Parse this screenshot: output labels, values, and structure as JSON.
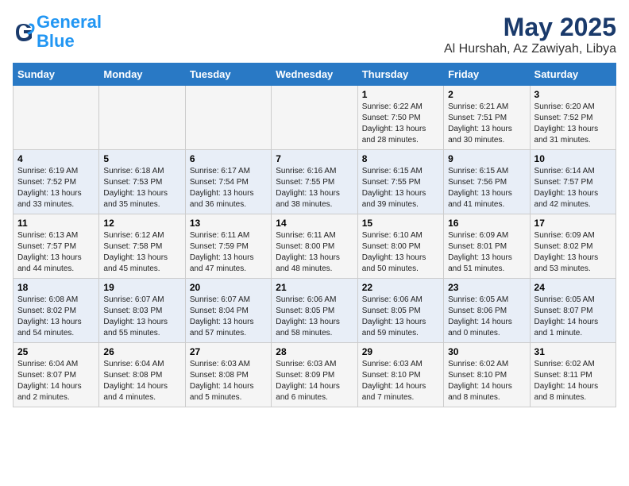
{
  "header": {
    "logo_line1": "General",
    "logo_line2": "Blue",
    "title": "May 2025",
    "subtitle": "Al Hurshah, Az Zawiyah, Libya"
  },
  "weekdays": [
    "Sunday",
    "Monday",
    "Tuesday",
    "Wednesday",
    "Thursday",
    "Friday",
    "Saturday"
  ],
  "weeks": [
    [
      {
        "day": "",
        "info": ""
      },
      {
        "day": "",
        "info": ""
      },
      {
        "day": "",
        "info": ""
      },
      {
        "day": "",
        "info": ""
      },
      {
        "day": "1",
        "info": "Sunrise: 6:22 AM\nSunset: 7:50 PM\nDaylight: 13 hours and 28 minutes."
      },
      {
        "day": "2",
        "info": "Sunrise: 6:21 AM\nSunset: 7:51 PM\nDaylight: 13 hours and 30 minutes."
      },
      {
        "day": "3",
        "info": "Sunrise: 6:20 AM\nSunset: 7:52 PM\nDaylight: 13 hours and 31 minutes."
      }
    ],
    [
      {
        "day": "4",
        "info": "Sunrise: 6:19 AM\nSunset: 7:52 PM\nDaylight: 13 hours and 33 minutes."
      },
      {
        "day": "5",
        "info": "Sunrise: 6:18 AM\nSunset: 7:53 PM\nDaylight: 13 hours and 35 minutes."
      },
      {
        "day": "6",
        "info": "Sunrise: 6:17 AM\nSunset: 7:54 PM\nDaylight: 13 hours and 36 minutes."
      },
      {
        "day": "7",
        "info": "Sunrise: 6:16 AM\nSunset: 7:55 PM\nDaylight: 13 hours and 38 minutes."
      },
      {
        "day": "8",
        "info": "Sunrise: 6:15 AM\nSunset: 7:55 PM\nDaylight: 13 hours and 39 minutes."
      },
      {
        "day": "9",
        "info": "Sunrise: 6:15 AM\nSunset: 7:56 PM\nDaylight: 13 hours and 41 minutes."
      },
      {
        "day": "10",
        "info": "Sunrise: 6:14 AM\nSunset: 7:57 PM\nDaylight: 13 hours and 42 minutes."
      }
    ],
    [
      {
        "day": "11",
        "info": "Sunrise: 6:13 AM\nSunset: 7:57 PM\nDaylight: 13 hours and 44 minutes."
      },
      {
        "day": "12",
        "info": "Sunrise: 6:12 AM\nSunset: 7:58 PM\nDaylight: 13 hours and 45 minutes."
      },
      {
        "day": "13",
        "info": "Sunrise: 6:11 AM\nSunset: 7:59 PM\nDaylight: 13 hours and 47 minutes."
      },
      {
        "day": "14",
        "info": "Sunrise: 6:11 AM\nSunset: 8:00 PM\nDaylight: 13 hours and 48 minutes."
      },
      {
        "day": "15",
        "info": "Sunrise: 6:10 AM\nSunset: 8:00 PM\nDaylight: 13 hours and 50 minutes."
      },
      {
        "day": "16",
        "info": "Sunrise: 6:09 AM\nSunset: 8:01 PM\nDaylight: 13 hours and 51 minutes."
      },
      {
        "day": "17",
        "info": "Sunrise: 6:09 AM\nSunset: 8:02 PM\nDaylight: 13 hours and 53 minutes."
      }
    ],
    [
      {
        "day": "18",
        "info": "Sunrise: 6:08 AM\nSunset: 8:02 PM\nDaylight: 13 hours and 54 minutes."
      },
      {
        "day": "19",
        "info": "Sunrise: 6:07 AM\nSunset: 8:03 PM\nDaylight: 13 hours and 55 minutes."
      },
      {
        "day": "20",
        "info": "Sunrise: 6:07 AM\nSunset: 8:04 PM\nDaylight: 13 hours and 57 minutes."
      },
      {
        "day": "21",
        "info": "Sunrise: 6:06 AM\nSunset: 8:05 PM\nDaylight: 13 hours and 58 minutes."
      },
      {
        "day": "22",
        "info": "Sunrise: 6:06 AM\nSunset: 8:05 PM\nDaylight: 13 hours and 59 minutes."
      },
      {
        "day": "23",
        "info": "Sunrise: 6:05 AM\nSunset: 8:06 PM\nDaylight: 14 hours and 0 minutes."
      },
      {
        "day": "24",
        "info": "Sunrise: 6:05 AM\nSunset: 8:07 PM\nDaylight: 14 hours and 1 minute."
      }
    ],
    [
      {
        "day": "25",
        "info": "Sunrise: 6:04 AM\nSunset: 8:07 PM\nDaylight: 14 hours and 2 minutes."
      },
      {
        "day": "26",
        "info": "Sunrise: 6:04 AM\nSunset: 8:08 PM\nDaylight: 14 hours and 4 minutes."
      },
      {
        "day": "27",
        "info": "Sunrise: 6:03 AM\nSunset: 8:08 PM\nDaylight: 14 hours and 5 minutes."
      },
      {
        "day": "28",
        "info": "Sunrise: 6:03 AM\nSunset: 8:09 PM\nDaylight: 14 hours and 6 minutes."
      },
      {
        "day": "29",
        "info": "Sunrise: 6:03 AM\nSunset: 8:10 PM\nDaylight: 14 hours and 7 minutes."
      },
      {
        "day": "30",
        "info": "Sunrise: 6:02 AM\nSunset: 8:10 PM\nDaylight: 14 hours and 8 minutes."
      },
      {
        "day": "31",
        "info": "Sunrise: 6:02 AM\nSunset: 8:11 PM\nDaylight: 14 hours and 8 minutes."
      }
    ]
  ]
}
